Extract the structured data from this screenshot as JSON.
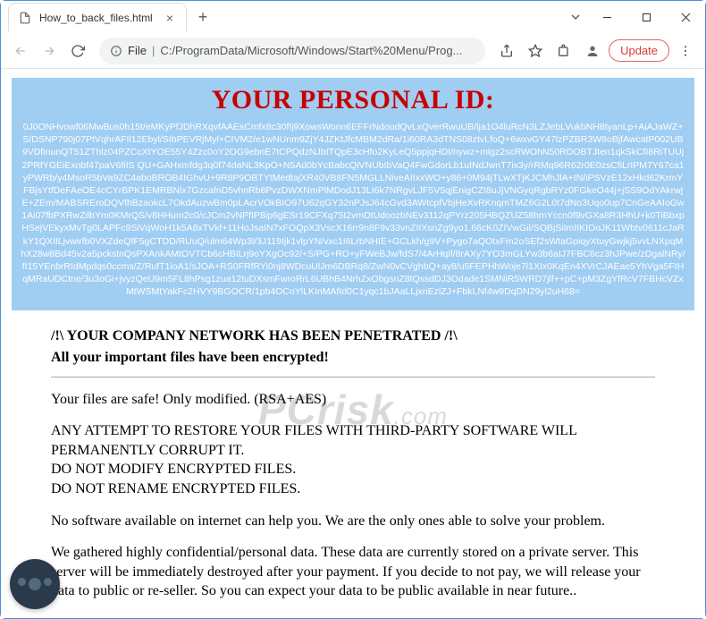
{
  "window": {
    "tab_title": "How_to_back_files.html",
    "new_tab_label": "+",
    "controls": {
      "minimize": "min",
      "maximize": "max",
      "close": "close",
      "dropdown": "v"
    }
  },
  "toolbar": {
    "omnibox_scheme_label": "File",
    "omnibox_url": "C:/ProgramData/Microsoft/Windows/Start%20Menu/Prog...",
    "update_label": "Update"
  },
  "page": {
    "id_title": "YOUR PERSONAL ID:",
    "id_blob": "0J0ONHvowf06MwBus0h15t/eMKyPfJDhRXqvfAAEsCmfx8c30fIj9XowsWonn6EFFrNdoudQvLxQverRwuUB/lja1O4luRcN3LZJebLVukbNH8tyanLp+AiAJaWZ+S/DSNP790j07PtVqhrAFIl12Ebyl/SIbPEVRjMyl+CIVM2/e1wNUnm9ZjY4JZKtJfcMBM2dRa/1i60RA3dTNS08ztvLfoQ+6wxvGY47lzPZBR3W8oBjfAwcatP002UB9VDfinunQT51ZThlz04PZCcXtYOE55Y4Zzc0oY2OG9ebnE7tCPQdzNJbITQpE3cHfo2KyLeQ5ppjqHDI/nywz+mlgz2scRWOhN50RDOBTJten1qkSkCfI8RiTUUj2PRfYGEiExnbf47paV6fiIS QU+GAHxmfdg3q0f74daNL3KpO+N5Ad0bYcBabcQiVNUbIbVaQ4FwGdorLb1uINdJwnT7ix3y/rRMq96R62r0E0zsCfiLrIPM7Y67ca1yPWRb/y4MsoR5bVa9ZC4aboBROB4IGhvU+9R8P9OBTYtMedtajXR40VB8FN5MGLLNiveAIIxxWO+y86+0M94jTLwXTjKJCMhJlA+tN/iPSVzE12xHkd62KrmYFBjsYtfDeFAeOE4cCYrBPK1EMRBNlx7GzcafnD5vhnRb8PvzDWXNmPlMDodJ13LI6k7NRgvLJF5V5qjEnigCZI8uJjVNGyqRgbRYz0FGkeO44j+jSS9OdYAkrwjE+ZEm/MABSREroDQVfhBzaokcL7OkdAuzwBm0pLAcrVOkBIO97U62qGY32nPJsJ64cGvd3AWtcpfVbjHeXvRKnqmTMZ6G2L0t7dNo3Uqo0up7CnGeAAIoGw1Ai07fbPXRwZilbYm0KMrQS/v8HHum2c0/cJCm2vNPfIP8ip6gESr19CFXq75t2vmDtUdoozbNEv3112qPYrz205HBQZUZ58hmYccn0f9vGXa8R3HhU+k0TiBbxpHSejVEkyxMvTg0LAPFc9SiVqWoH1k5A8xTVkf+11HoJsaIN7xFOQpX3VscX16rr9n8F9v33vnZIIXsnZg9yo1.66cK0ZIVwGil/SQBjSiImIIKIOoJK11Wbtv0611cJaRkY1QXIILjvwirfb0VXZdeQfF5gCTDD/RUuQ/ulm64Wp3l/3J119Ijk1vlpYN/vxc1I6LrbNHIE+GCLkh/g9V+Pygo7aQOtxFm2oSEf2sWtaGpiqyXtuyGwjkj5vvLNXpqMhX28w8Bd45v2a5pckstnQsPXAnkAMtOVTCb6cHBILrj9oYXgOc92/+S/PG+RO+yFWeBJw/fdS7/4ArHqif/8rAXy7YO3mGLYw3b6aIJ7FBC6cz3hJPwe/zDgalNRy/fI15YEnbrRIdMpdqs0ccms/Z/RufT1ioA1/sJOA+RS0FRfRYi0nj8WDcuUlJm6DBRq8/ZwN0vCVghbQ+ay8/u5FEPHhWoje7l1XIx0KqEn4XVrCJAEae5YhVga5FtHqMRaUDCtne/3u3oGi+jvyzQeU9m5FL8hPsg1zua12tuDXsmFwroRrL6UBhB4NrhZxObgsnZ8tQssdDJ3Odade1SMNiR5WRD7jlf++pC+pM3ZgYfRcV7FBHcVZxMtWSMtYakFc2HVY9BGOCR/1pb4OCoYlLKInMAfId0C1yqc1bJAaLLjxnEzlZJ+FbkLNf4w9DqDN29yl2uH68=",
    "warning_line": "/!\\ YOUR COMPANY NETWORK HAS BEEN PENETRATED /!\\",
    "sub_warning": "All your important files have been encrypted!",
    "para1": "Your files are safe! Only modified. (RSA+AES)",
    "para2": "ANY ATTEMPT TO RESTORE YOUR FILES WITH THIRD-PARTY SOFTWARE WILL PERMANENTLY CORRUPT IT.\nDO NOT MODIFY ENCRYPTED FILES.\nDO NOT RENAME ENCRYPTED FILES.",
    "para3": "No software available on internet can help you. We are the only ones able to solve your problem.",
    "para4": "We gathered highly confidential/personal data. These data are currently stored on a private server. This server will be immediately destroyed after your payment. If you decide to not pay, we will release your data to public or re-seller. So you can expect your data to be public available in near future.."
  },
  "watermark": {
    "main": "PCrisk",
    "suffix": ".com"
  }
}
